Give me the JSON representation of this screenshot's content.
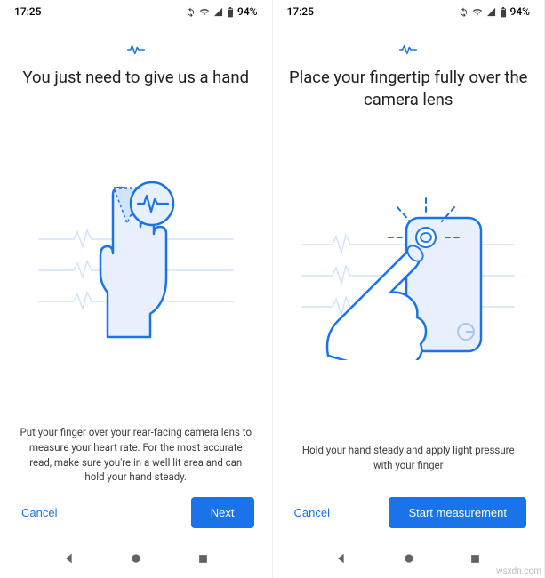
{
  "status": {
    "time": "17:25",
    "battery": "94%"
  },
  "screens": [
    {
      "title": "You just need to give us a hand",
      "description": "Put your finger over your rear-facing camera lens to measure your heart rate. For the most accurate read, make sure you're in a well lit area and can hold your hand steady.",
      "cancel": "Cancel",
      "primary": "Next"
    },
    {
      "title": "Place your fingertip fully over the camera lens",
      "description": "Hold your hand steady and apply light pressure with your finger",
      "cancel": "Cancel",
      "primary": "Start measurement"
    }
  ],
  "watermark": "wsxdn.com"
}
